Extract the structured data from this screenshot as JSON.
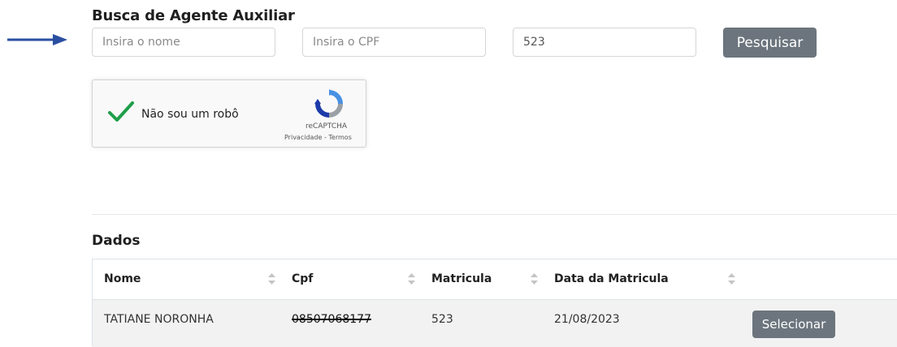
{
  "search": {
    "title": "Busca de Agente Auxiliar",
    "name_placeholder": "Insira o nome",
    "cpf_placeholder": "Insira o CPF",
    "matricula_value": "523",
    "submit_label": "Pesquisar"
  },
  "captcha": {
    "label": "Não sou um robô",
    "brand": "reCAPTCHA",
    "links": "Privacidade - Termos",
    "checked": true
  },
  "results": {
    "title": "Dados",
    "columns": [
      "Nome",
      "Cpf",
      "Matricula",
      "Data da Matricula",
      ""
    ],
    "rows": [
      {
        "nome": "TATIANE NORONHA",
        "cpf": "08507068177",
        "matricula": "523",
        "data": "21/08/2023",
        "action": "Selecionar"
      }
    ]
  },
  "colors": {
    "button": "#6c757d",
    "arrow": "#2a4fa0",
    "check": "#1e9e4a",
    "row_bg": "#f2f2f2"
  }
}
